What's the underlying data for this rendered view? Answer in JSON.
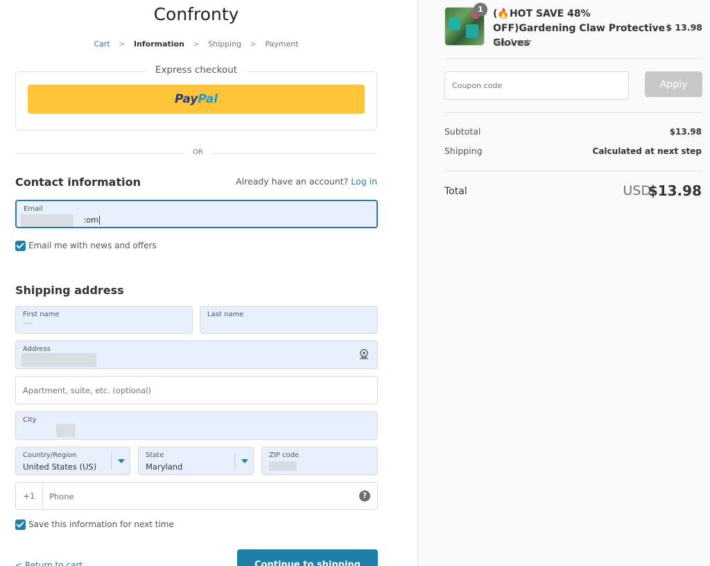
{
  "store": {
    "name": "Confronty"
  },
  "breadcrumb": {
    "cart": "Cart",
    "information": "Information",
    "shipping": "Shipping",
    "payment": "Payment",
    "separator": ">"
  },
  "express": {
    "title": "Express checkout",
    "paypal_part1": "Pay",
    "paypal_part2": "Pal"
  },
  "divider": {
    "or": "OR"
  },
  "contact": {
    "title": "Contact information",
    "account_prompt": "Already have an account?",
    "login_link": "Log in",
    "email_label": "Email",
    "email_value_tail": "om",
    "newsletter_label": "Email me with news and offers",
    "newsletter_checked": true
  },
  "shipping_address": {
    "title": "Shipping address",
    "first_name_label": "First name",
    "last_name_label": "Last name",
    "address_label": "Address",
    "apartment_placeholder": "Apartment, suite, etc. (optional)",
    "city_label": "City",
    "country_label": "Country/Region",
    "country_value": "United States (US)",
    "state_label": "State",
    "state_value": "Maryland",
    "zip_label": "ZIP code",
    "phone_prefix": "+1",
    "phone_placeholder": "Phone",
    "help_icon": "?",
    "save_info_label": "Save this information for next time",
    "save_info_checked": true
  },
  "footer": {
    "return_link": "< Return to cart",
    "continue_button": "Continue to shipping"
  },
  "summary": {
    "product": {
      "quantity": "1",
      "title": "(🔥HOT SAVE 48% OFF)Gardening Claw Protective Gloves",
      "variant": "buy 1 pair",
      "price": "$ 13.98"
    },
    "coupon_placeholder": "Coupon code",
    "apply_button": "Apply",
    "subtotal_label": "Subtotal",
    "subtotal_value": "$13.98",
    "shipping_label": "Shipping",
    "shipping_value": "Calculated at next step",
    "total_label": "Total",
    "total_currency": "USD",
    "total_value": "$13.98"
  },
  "colors": {
    "accent": "#1f7fa8",
    "paypal_yellow": "#ffc439",
    "autofill_bg": "#e8f0fe",
    "apply_disabled": "#c8c8c8"
  }
}
